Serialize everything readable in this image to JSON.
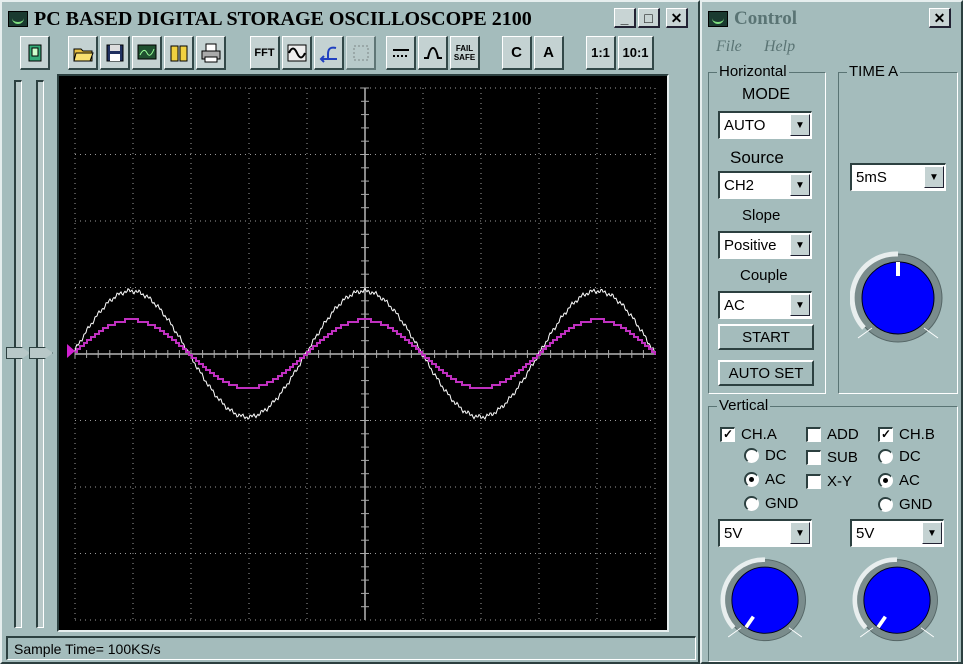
{
  "osc": {
    "title": "PC BASED DIGITAL STORAGE OSCILLOSCOPE 2100",
    "minimize": "_",
    "maximize": "□",
    "close": "✕",
    "toolbar": {
      "fft": "FFT",
      "fail": "FAIL",
      "safe": "SAFE",
      "ratio1": "1:1",
      "ratio10": "10:1",
      "cursor_c": "C",
      "cursor_a": "A"
    },
    "status": "Sample Time= 100KS/s"
  },
  "control": {
    "title": "Control",
    "close": "✕",
    "menu": {
      "file": "File",
      "help": "Help"
    },
    "horizontal": {
      "label": "Horizontal",
      "mode_label": "MODE",
      "mode_value": "AUTO",
      "source_label": "Source",
      "source_value": "CH2",
      "slope_label": "Slope",
      "slope_value": "Positive",
      "couple_label": "Couple",
      "couple_value": "AC",
      "start": "START",
      "auto_set": "AUTO SET"
    },
    "time_a": {
      "label": "TIME A",
      "value": "5mS",
      "knob_level": 0.5
    },
    "vertical": {
      "label": "Vertical",
      "ch_a": {
        "label": "CH.A",
        "checked": true
      },
      "add": {
        "label": "ADD",
        "checked": false
      },
      "ch_b": {
        "label": "CH.B",
        "checked": true
      },
      "sub": {
        "label": "SUB",
        "checked": false
      },
      "xy": {
        "label": "X-Y",
        "checked": false
      },
      "a_couple": {
        "dc": "DC",
        "ac": "AC",
        "gnd": "GND",
        "selected": "AC"
      },
      "b_couple": {
        "dc": "DC",
        "ac": "AC",
        "gnd": "GND",
        "selected": "AC"
      },
      "a_volts": "5V",
      "b_volts": "5V",
      "check_mark": "✓",
      "select_arrow": "▼"
    }
  },
  "colors": {
    "accent": "#d020d0",
    "knob": "#0000ff",
    "trace_a": "#ffffff",
    "trace_b": "#c030c0"
  }
}
